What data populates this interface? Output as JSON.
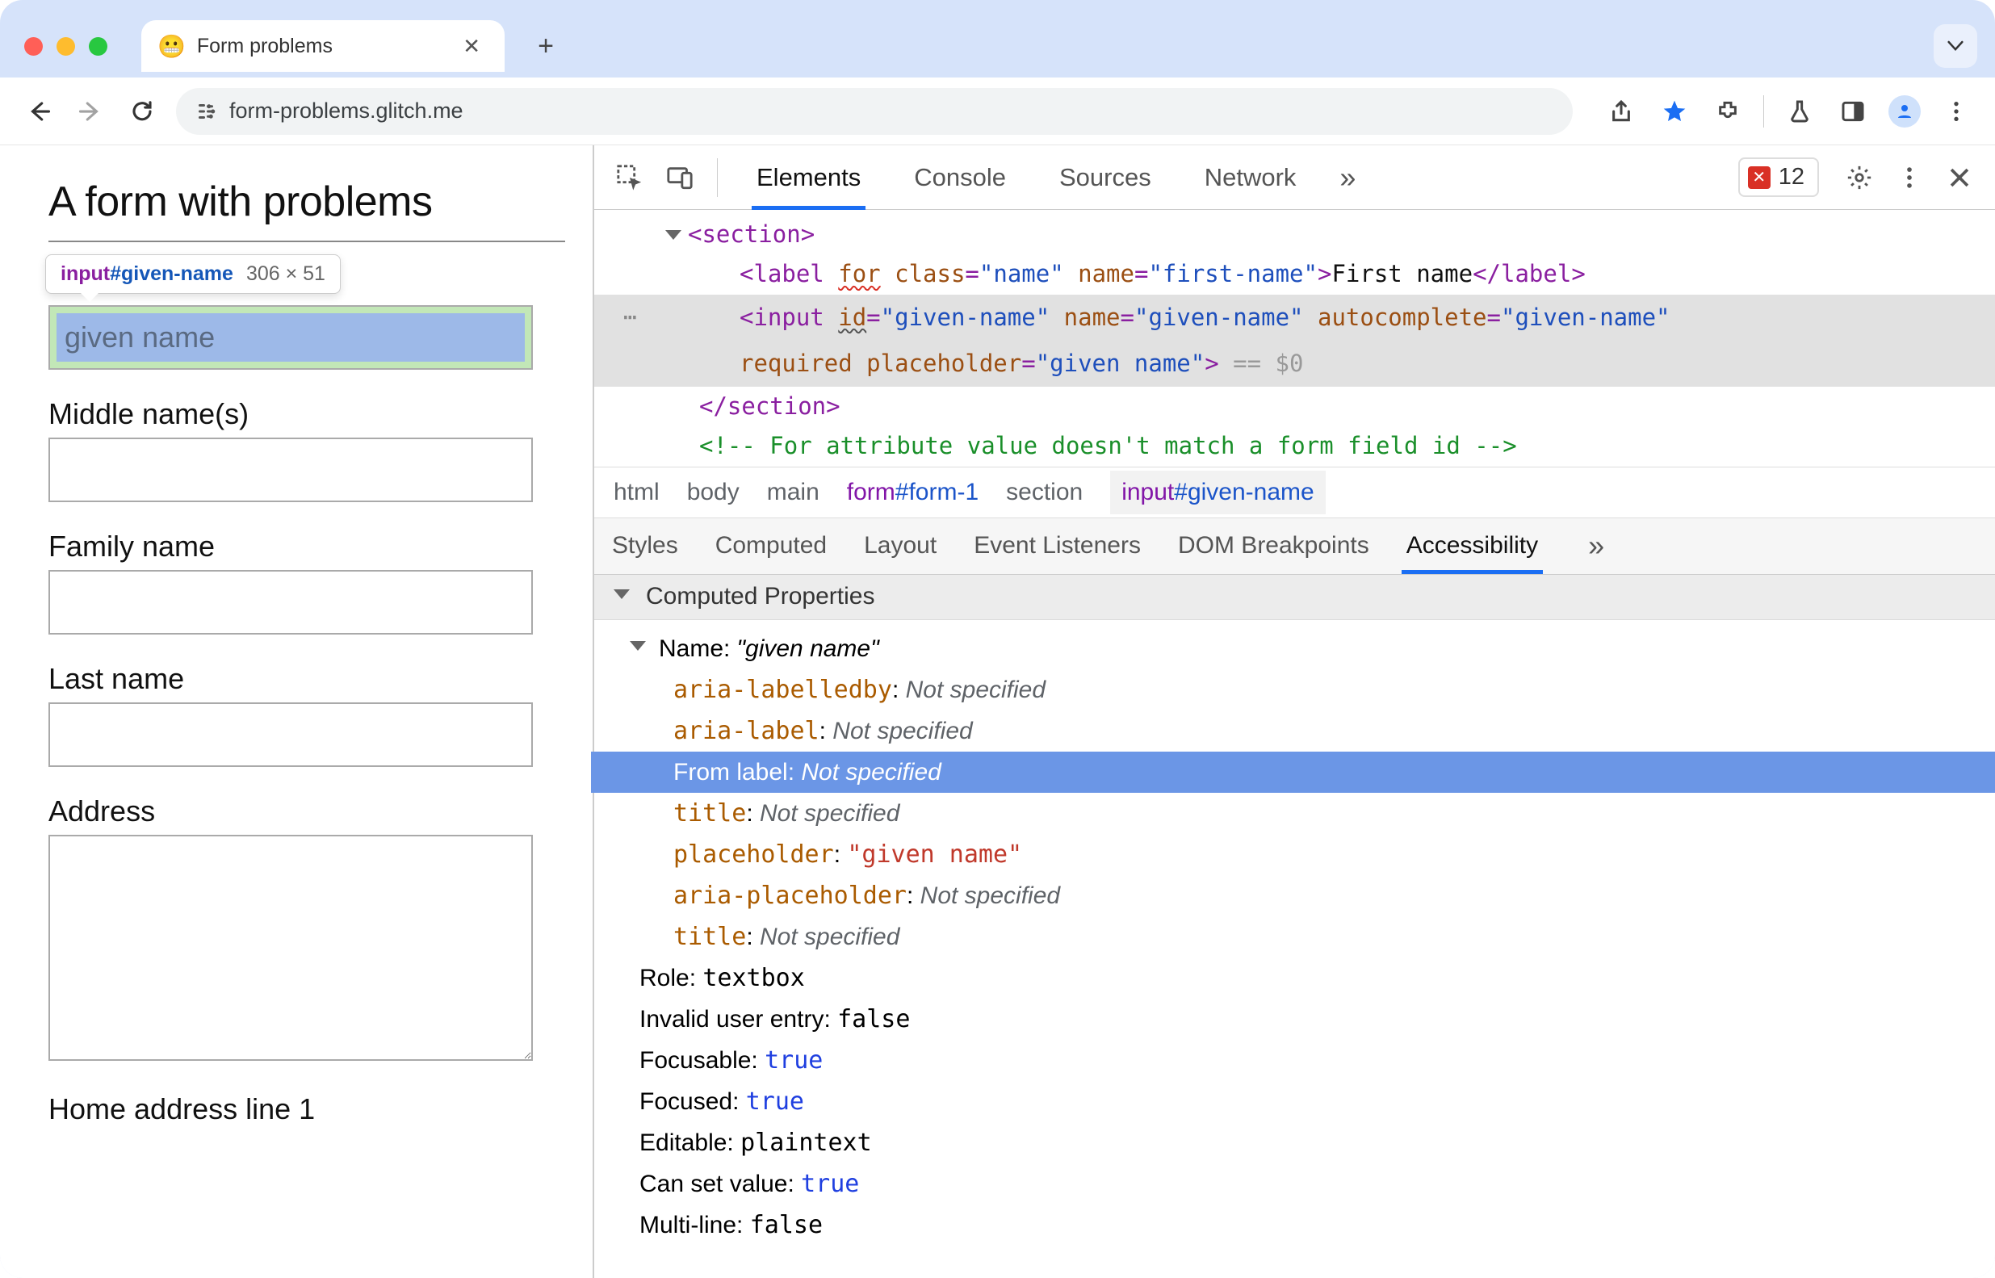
{
  "tab": {
    "title": "Form problems",
    "favicon": "😬"
  },
  "url": "form-problems.glitch.me",
  "tooltip": {
    "tag": "input",
    "id": "#given-name",
    "dims": "306 × 51"
  },
  "page": {
    "title": "A form with problems",
    "first_name_label": "First name",
    "given_placeholder": "given name",
    "middle_label": "Middle name(s)",
    "family_label": "Family name",
    "last_label": "Last name",
    "address_label": "Address",
    "home_addr_label": "Home address line 1"
  },
  "devtools": {
    "tabs": {
      "elements": "Elements",
      "console": "Console",
      "sources": "Sources",
      "network": "Network"
    },
    "errors": "12",
    "dom": {
      "section_open": "section",
      "label_tag": "label",
      "label_for_attr": "for",
      "label_class_attr": "class",
      "label_class_val": "name",
      "label_name_attr": "name",
      "label_name_val": "first-name",
      "label_text": "First name",
      "input_tag": "input",
      "input_id_attr": "id",
      "input_id_val": "given-name",
      "input_name_attr": "name",
      "input_name_val": "given-name",
      "input_ac_attr": "autocomplete",
      "input_ac_val": "given-name",
      "input_req": "required",
      "input_ph_attr": "placeholder",
      "input_ph_val": "given name",
      "eq0": " == $0",
      "section_close": "section",
      "comment": "<!-- For attribute value doesn't match a form field id -->"
    },
    "breadcrumb": {
      "b0": "html",
      "b1": "body",
      "b2": "main",
      "b3_tag": "form",
      "b3_id": "#form-1",
      "b4": "section",
      "b5_tag": "input",
      "b5_id": "#given-name"
    },
    "subtabs": {
      "styles": "Styles",
      "computed": "Computed",
      "layout": "Layout",
      "events": "Event Listeners",
      "dombp": "DOM Breakpoints",
      "a11y": "Accessibility"
    },
    "section_title": "Computed Properties",
    "props": {
      "name_label": "Name: ",
      "name_value": "\"given name\"",
      "aria_labelledby_k": "aria-labelledby",
      "aria_label_k": "aria-label",
      "from_label_k": "From label: ",
      "title_k": "title",
      "placeholder_k": "placeholder",
      "placeholder_v": "\"given name\"",
      "aria_placeholder_k": "aria-placeholder",
      "not_spec": "Not specified",
      "role_k": "Role: ",
      "role_v": "textbox",
      "invalid_k": "Invalid user entry: ",
      "invalid_v": "false",
      "focusable_k": "Focusable: ",
      "focusable_v": "true",
      "focused_k": "Focused: ",
      "focused_v": "true",
      "editable_k": "Editable: ",
      "editable_v": "plaintext",
      "cansetv_k": "Can set value: ",
      "cansetv_v": "true",
      "multiline_k": "Multi-line: ",
      "multiline_v": "false"
    }
  }
}
